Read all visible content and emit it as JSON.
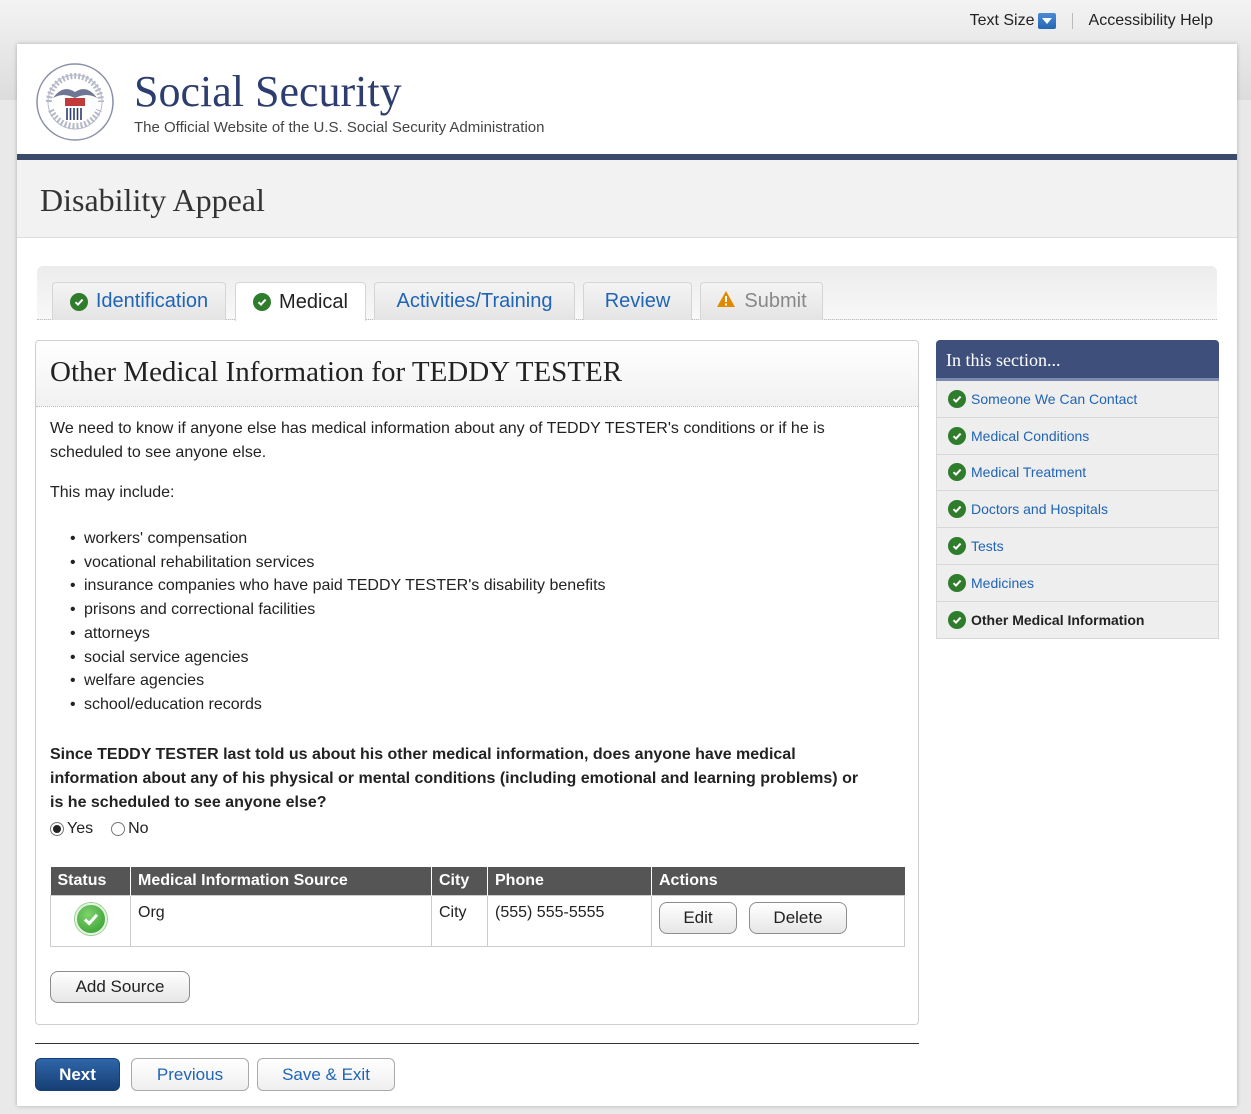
{
  "utility": {
    "text_size_label": "Text Size",
    "accessibility_label": "Accessibility Help"
  },
  "header": {
    "site_title": "Social Security",
    "site_subtitle": "The Official Website of the U.S. Social Security Administration",
    "seal_text_top": "SOCIAL SECURITY",
    "seal_text_bottom": "ADMINISTRATION",
    "seal_usa": "USA"
  },
  "banner": {
    "title": "Disability Appeal"
  },
  "tabs": [
    {
      "label": "Identification",
      "state": "complete"
    },
    {
      "label": "Medical",
      "state": "active"
    },
    {
      "label": "Activities/Training",
      "state": "link"
    },
    {
      "label": "Review",
      "state": "link"
    },
    {
      "label": "Submit",
      "state": "warning"
    }
  ],
  "main": {
    "title": "Other Medical Information for TEDDY TESTER",
    "intro": "We need to know if anyone else has medical information about any of TEDDY TESTER's conditions or if he is scheduled to see anyone else.",
    "may_include": "This may include:",
    "list": [
      "workers' compensation",
      "vocational rehabilitation services",
      "insurance companies who have paid TEDDY TESTER's disability benefits",
      "prisons and correctional facilities",
      "attorneys",
      "social service agencies",
      "welfare agencies",
      "school/education records"
    ],
    "question": "Since TEDDY TESTER last told us about his other medical information, does anyone have medical information about any of his physical or mental conditions (including emotional and learning problems) or is he scheduled to see anyone else?",
    "radio_yes": "Yes",
    "radio_no": "No",
    "selected": "Yes",
    "table": {
      "headers": [
        "Status",
        "Medical Information Source",
        "City",
        "Phone",
        "Actions"
      ],
      "rows": [
        {
          "source": "Org",
          "city": "City",
          "phone": "(555) 555-5555"
        }
      ],
      "edit_label": "Edit",
      "delete_label": "Delete"
    },
    "add_source_label": "Add Source"
  },
  "sidebar": {
    "title": "In this section...",
    "items": [
      {
        "label": "Someone We Can Contact"
      },
      {
        "label": "Medical Conditions"
      },
      {
        "label": "Medical Treatment"
      },
      {
        "label": "Doctors and Hospitals"
      },
      {
        "label": "Tests"
      },
      {
        "label": "Medicines"
      },
      {
        "label": "Other Medical Information",
        "current": true
      }
    ]
  },
  "footer": {
    "next_label": "Next",
    "previous_label": "Previous",
    "save_exit_label": "Save & Exit"
  },
  "colors": {
    "brand_navy": "#2c3d6e",
    "link_blue": "#1f64b5",
    "success_green": "#2f7c2c",
    "warning_orange": "#e08a00"
  }
}
